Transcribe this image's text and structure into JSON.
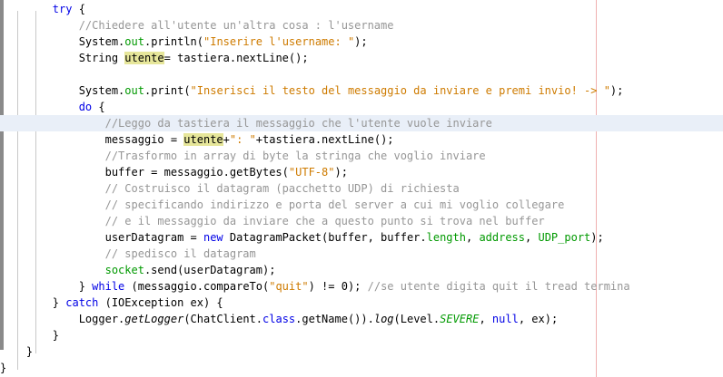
{
  "code_lines": [
    {
      "segs": [
        {
          "t": "        "
        },
        {
          "t": "try",
          "c": "kw"
        },
        {
          "t": " {"
        }
      ]
    },
    {
      "segs": [
        {
          "t": "            "
        },
        {
          "t": "//Chiedere all'utente un'altra cosa : l'username",
          "c": "cm"
        }
      ]
    },
    {
      "segs": [
        {
          "t": "            System."
        },
        {
          "t": "out",
          "c": "fld"
        },
        {
          "t": ".println("
        },
        {
          "t": "\"Inserire l'username: \"",
          "c": "str"
        },
        {
          "t": ");"
        }
      ]
    },
    {
      "segs": [
        {
          "t": "            String "
        },
        {
          "t": "utente",
          "c": "mark"
        },
        {
          "t": "= tastiera.nextLine();"
        }
      ]
    },
    {
      "segs": [
        {
          "t": ""
        }
      ]
    },
    {
      "segs": [
        {
          "t": "            System."
        },
        {
          "t": "out",
          "c": "fld"
        },
        {
          "t": ".print("
        },
        {
          "t": "\"Inserisci il testo del messaggio da inviare e premi invio! -> \"",
          "c": "str"
        },
        {
          "t": ");"
        }
      ]
    },
    {
      "segs": [
        {
          "t": "            "
        },
        {
          "t": "do",
          "c": "kw"
        },
        {
          "t": " {"
        }
      ]
    },
    {
      "segs": [
        {
          "t": "                "
        },
        {
          "t": "//Leggo da tastiera il messaggio che l'utente vuole inviare",
          "c": "cm"
        }
      ],
      "highlight": true
    },
    {
      "segs": [
        {
          "t": "                messaggio = "
        },
        {
          "t": "utente",
          "c": "mark"
        },
        {
          "t": "+"
        },
        {
          "t": "\": \"",
          "c": "str"
        },
        {
          "t": "+tastiera.nextLine();"
        }
      ]
    },
    {
      "segs": [
        {
          "t": "                "
        },
        {
          "t": "//Trasformo in array di byte la stringa che voglio inviare",
          "c": "cm"
        }
      ]
    },
    {
      "segs": [
        {
          "t": "                buffer = messaggio.getBytes("
        },
        {
          "t": "\"UTF-8\"",
          "c": "str"
        },
        {
          "t": ");"
        }
      ]
    },
    {
      "segs": [
        {
          "t": "                "
        },
        {
          "t": "// Costruisco il datagram (pacchetto UDP) di richiesta",
          "c": "cm"
        }
      ]
    },
    {
      "segs": [
        {
          "t": "                "
        },
        {
          "t": "// specificando indirizzo e porta del server a cui mi voglio collegare",
          "c": "cm"
        }
      ]
    },
    {
      "segs": [
        {
          "t": "                "
        },
        {
          "t": "// e il messaggio da inviare che a questo punto si trova nel buffer",
          "c": "cm"
        }
      ]
    },
    {
      "segs": [
        {
          "t": "                userDatagram = "
        },
        {
          "t": "new",
          "c": "kw"
        },
        {
          "t": " DatagramPacket(buffer, buffer."
        },
        {
          "t": "length",
          "c": "fld"
        },
        {
          "t": ", "
        },
        {
          "t": "address",
          "c": "fld"
        },
        {
          "t": ", "
        },
        {
          "t": "UDP_port",
          "c": "fld"
        },
        {
          "t": ");"
        }
      ]
    },
    {
      "segs": [
        {
          "t": "                "
        },
        {
          "t": "// spedisco il datagram",
          "c": "cm"
        }
      ]
    },
    {
      "segs": [
        {
          "t": "                "
        },
        {
          "t": "socket",
          "c": "fld"
        },
        {
          "t": ".send(userDatagram);"
        }
      ]
    },
    {
      "segs": [
        {
          "t": "            } "
        },
        {
          "t": "while",
          "c": "kw"
        },
        {
          "t": " (messaggio.compareTo("
        },
        {
          "t": "\"quit\"",
          "c": "str"
        },
        {
          "t": ") != 0); "
        },
        {
          "t": "//se utente digita quit il tread termina",
          "c": "cm"
        }
      ]
    },
    {
      "segs": [
        {
          "t": "        } "
        },
        {
          "t": "catch",
          "c": "kw"
        },
        {
          "t": " (IOException ex) {"
        }
      ]
    },
    {
      "segs": [
        {
          "t": "            Logger."
        },
        {
          "t": "getLogger",
          "c": "it"
        },
        {
          "t": "(ChatClient."
        },
        {
          "t": "class",
          "c": "kw"
        },
        {
          "t": ".getName())."
        },
        {
          "t": "log",
          "c": "it"
        },
        {
          "t": "(Level."
        },
        {
          "t": "SEVERE",
          "c": "fldi"
        },
        {
          "t": ", "
        },
        {
          "t": "null",
          "c": "kw"
        },
        {
          "t": ", ex);"
        }
      ]
    },
    {
      "segs": [
        {
          "t": "        }"
        }
      ]
    },
    {
      "segs": [
        {
          "t": "    }"
        }
      ]
    },
    {
      "segs": [
        {
          "t": "}"
        }
      ]
    }
  ]
}
